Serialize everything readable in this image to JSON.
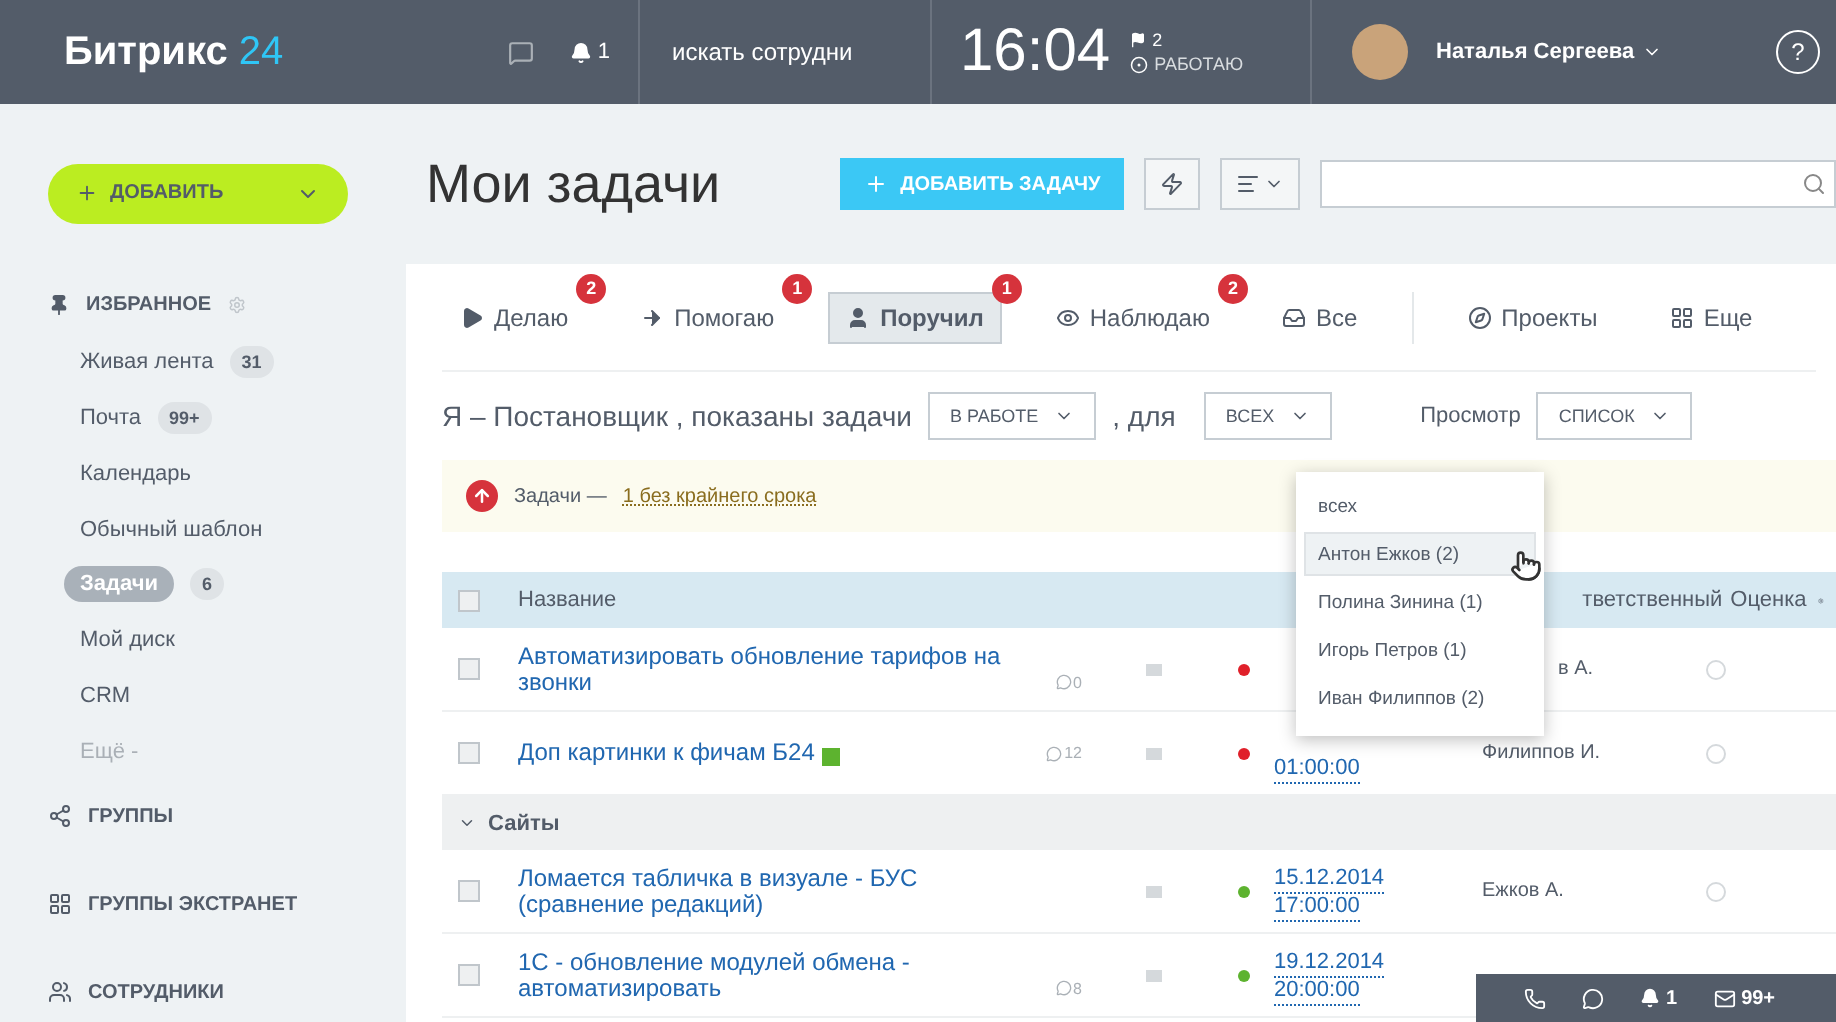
{
  "header": {
    "logo": "Битрикс",
    "logo_accent": "24",
    "notifications": "1",
    "search": {
      "placeholder": "искать сотрудни"
    },
    "time": "16:04",
    "flag_count": "2",
    "status": "РАБОТАЮ",
    "user": "Наталья Сергеева",
    "help": "?"
  },
  "sidebar": {
    "add_button": "ДОБАВИТЬ",
    "favorites": "ИЗБРАННОЕ",
    "items": [
      {
        "label": "Живая лента",
        "counter": "31",
        "selected": false,
        "kind": "link"
      },
      {
        "label": "Почта",
        "counter": "99+",
        "selected": false,
        "kind": "link"
      },
      {
        "label": "Календарь",
        "selected": false,
        "kind": "link"
      },
      {
        "label": "Обычный шаблон",
        "selected": false,
        "kind": "link"
      },
      {
        "label": "Задачи",
        "counter": "6",
        "selected": true,
        "kind": "link"
      },
      {
        "label": "Мой диск",
        "selected": false,
        "kind": "link"
      },
      {
        "label": "CRM",
        "selected": false,
        "kind": "link"
      },
      {
        "label": "Ещё -",
        "selected": false,
        "kind": "more"
      }
    ],
    "sections": [
      {
        "label": "ГРУППЫ",
        "kind": "share"
      },
      {
        "label": "ГРУППЫ ЭКСТРАНЕТ",
        "kind": "blocks"
      },
      {
        "label": "СОТРУДНИКИ",
        "kind": "people"
      }
    ]
  },
  "page": {
    "title": "Мои задачи",
    "add_task": "ДОБАВИТЬ ЗАДАЧУ"
  },
  "tabs": [
    {
      "label": "Делаю",
      "badge": "2",
      "selected": false,
      "kind": "play"
    },
    {
      "label": "Помогаю",
      "badge": "1",
      "selected": false,
      "kind": "arrow"
    },
    {
      "label": "Поручил",
      "badge": "1",
      "selected": true,
      "kind": "person"
    },
    {
      "label": "Наблюдаю",
      "badge": "2",
      "selected": false,
      "kind": "eye"
    },
    {
      "label": "Все",
      "selected": false,
      "kind": "tray"
    },
    {
      "label": "Проекты",
      "selected": false,
      "kind": "compass"
    },
    {
      "label": "Еще",
      "selected": false,
      "kind": "grid"
    }
  ],
  "filter": {
    "prefix": "Я – Постановщик , показаны задачи",
    "status": "В РАБОТЕ",
    "for": ", для",
    "whom": "ВСЕХ",
    "view_label": "Просмотр",
    "view": "СПИСОК"
  },
  "alert": {
    "text": "Задачи —",
    "link": "1 без крайнего срока"
  },
  "table": {
    "all_checked": false,
    "columns": [
      "Название",
      "тветственный",
      "Оценка"
    ],
    "rows": [
      {
        "kind": "task",
        "checked": false,
        "title": "Автоматизировать обновление тарифов на звонки",
        "comments": "0",
        "color": "#e0202a",
        "time": "",
        "responsible": "в А."
      },
      {
        "kind": "task",
        "checked": false,
        "title": "Доп картинки к фичам Б24",
        "tag": true,
        "comments": "12",
        "color": "#e0202a",
        "time": "01:00:00",
        "responsible": "Филиппов И."
      },
      {
        "kind": "group",
        "title": "Сайты"
      },
      {
        "kind": "task",
        "checked": false,
        "title": "Ломается табличка в визуале - БУС (сравнение редакций)",
        "color": "#5db32f",
        "date": "15.12.2014",
        "time": "17:00:00",
        "responsible": "Ежков А."
      },
      {
        "kind": "task",
        "checked": false,
        "title": "1С - обновление модулей обмена - автоматизировать",
        "comments": "8",
        "color": "#5db32f",
        "date": "19.12.2014",
        "time": "20:00:00",
        "responsible": ""
      }
    ]
  },
  "dropdown": [
    {
      "label": "всех",
      "selected": false
    },
    {
      "label": "Антон Ежков (2)",
      "selected": true
    },
    {
      "label": "Полина Зинина (1)",
      "selected": false
    },
    {
      "label": "Игорь Петров (1)",
      "selected": false
    },
    {
      "label": "Иван Филиппов (2)",
      "selected": false
    }
  ],
  "bottom_bar": {
    "notifications": "1",
    "mail": "99+"
  }
}
